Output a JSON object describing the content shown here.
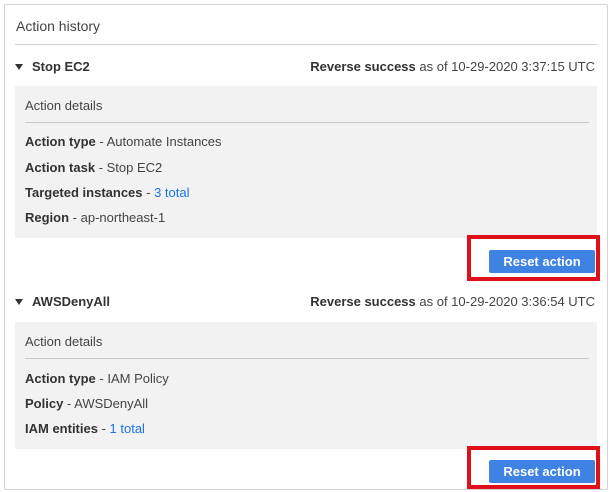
{
  "panel": {
    "title": "Action history"
  },
  "sections": [
    {
      "name": "Stop EC2",
      "status_label": "Reverse success",
      "status_suffix": "as of 10-29-2020 3:37:15 UTC",
      "details_title": "Action details",
      "rows": [
        {
          "key": "Action type",
          "sep": " - ",
          "value": "Automate Instances"
        },
        {
          "key": "Action task",
          "sep": " - ",
          "value": "Stop EC2"
        },
        {
          "key": "Targeted instances",
          "sep": " - ",
          "value": "3 total"
        },
        {
          "key": "Region",
          "sep": " - ",
          "value": "ap-northeast-1"
        }
      ],
      "button_label": "Reset action"
    },
    {
      "name": "AWSDenyAll",
      "status_label": "Reverse success",
      "status_suffix": "as of 10-29-2020 3:36:54 UTC",
      "details_title": "Action details",
      "rows": [
        {
          "key": "Action type",
          "sep": " - ",
          "value": "IAM Policy"
        },
        {
          "key": "Policy",
          "sep": " - ",
          "value": "AWSDenyAll"
        },
        {
          "key": "IAM entities",
          "sep": " - ",
          "value": "1 total"
        }
      ],
      "button_label": "Reset action"
    }
  ],
  "colors": {
    "link": "#1a73e8",
    "button": "#3e82e4",
    "highlight": "#e0101a",
    "details_bg": "#f2f2f2"
  },
  "icons": {
    "collapse": "caret-down-icon"
  }
}
